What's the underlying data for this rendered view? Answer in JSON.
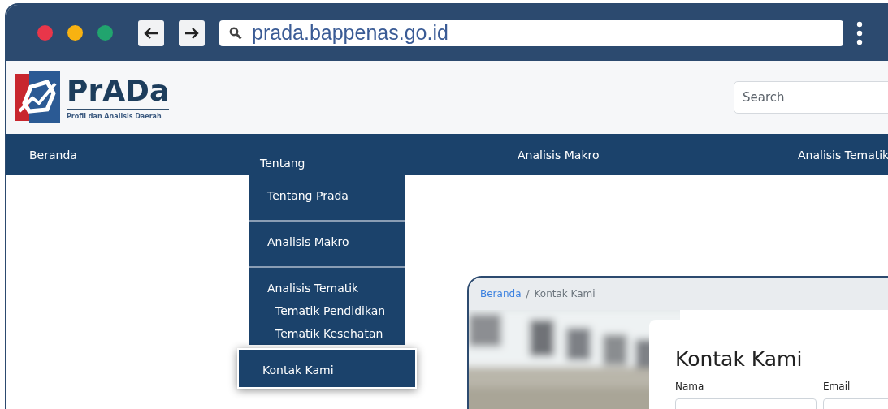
{
  "browser": {
    "url": "prada.bappenas.go.id"
  },
  "site": {
    "logo_title": "PrADa",
    "logo_subtitle": "Profil dan Analisis Daerah",
    "search": {
      "placeholder": "Search"
    },
    "nav": [
      {
        "label": "Beranda",
        "expanded": false
      },
      {
        "label": "Tentang",
        "expanded": true
      },
      {
        "label": "Analisis Makro",
        "expanded": false
      },
      {
        "label": "Analisis Tematik",
        "expanded": false
      }
    ],
    "dropdown": [
      {
        "label": "Tentang Prada",
        "selected": false
      },
      {
        "label": "Analisis Makro",
        "selected": false
      },
      {
        "label": "Analisis Tematik",
        "selected": false,
        "children": [
          {
            "label": "Tematik Pendidikan"
          },
          {
            "label": "Tematik Kesehatan"
          }
        ]
      },
      {
        "label": "Kontak Kami",
        "selected": true
      }
    ]
  },
  "preview": {
    "breadcrumb": [
      {
        "label": "Beranda",
        "kind": "link"
      },
      {
        "label": "Kontak Kami",
        "kind": "current"
      }
    ],
    "separator": "/",
    "form": {
      "title": "Kontak Kami",
      "fields": [
        {
          "label": "Nama"
        },
        {
          "label": "Email"
        }
      ]
    }
  }
}
